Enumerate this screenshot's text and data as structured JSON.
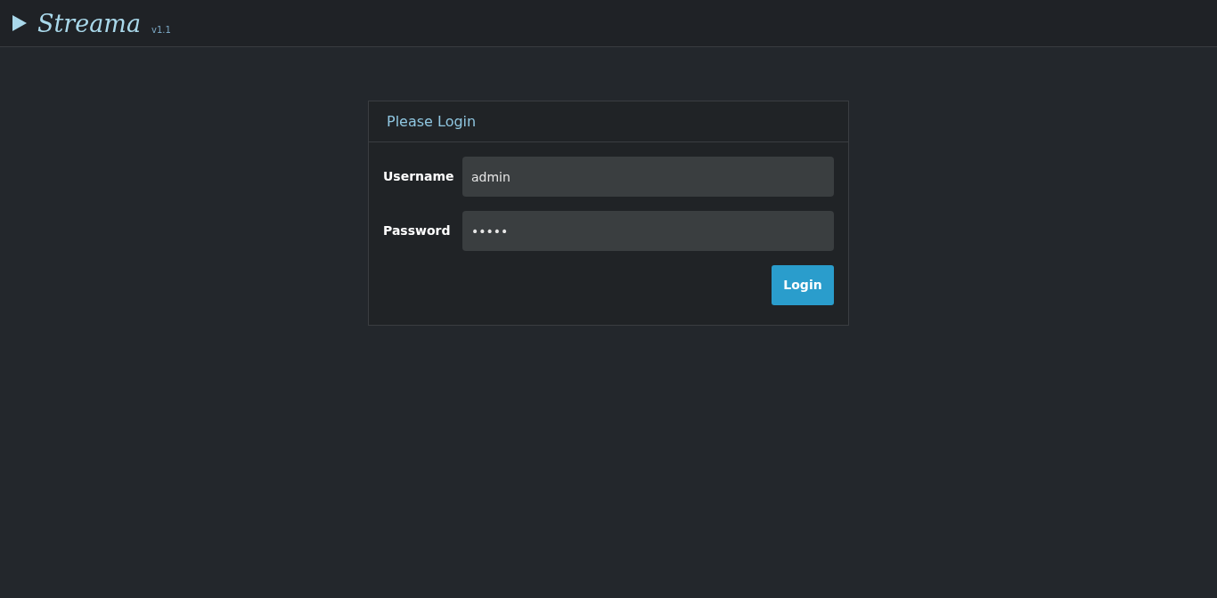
{
  "navbar": {
    "brand": "Streama",
    "version": "v1.1"
  },
  "login_panel": {
    "title": "Please Login",
    "fields": [
      {
        "label": "Username",
        "value": "admin"
      },
      {
        "label": "Password",
        "value": "•••••"
      }
    ],
    "button": "Login"
  }
}
